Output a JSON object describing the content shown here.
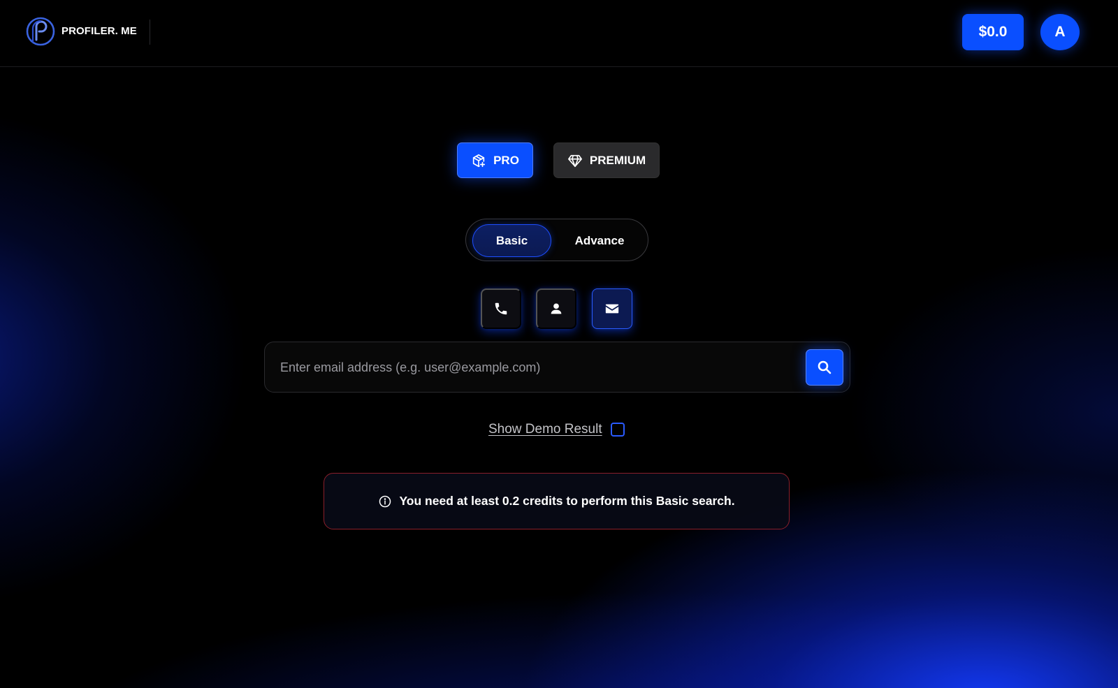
{
  "header": {
    "brand": "PROFILER. ME",
    "balance": "$0.0",
    "avatar_initial": "A"
  },
  "plans": [
    {
      "label": "PRO",
      "icon": "box-plus-icon",
      "selected": true
    },
    {
      "label": "PREMIUM",
      "icon": "diamond-icon",
      "selected": false
    }
  ],
  "mode": {
    "options": [
      "Basic",
      "Advance"
    ],
    "selected": "Basic"
  },
  "search_types": [
    {
      "icon": "phone-icon",
      "selected": false
    },
    {
      "icon": "person-icon",
      "selected": false
    },
    {
      "icon": "mail-icon",
      "selected": true
    }
  ],
  "search": {
    "placeholder": "Enter email address (e.g. user@example.com)",
    "value": ""
  },
  "demo": {
    "label": "Show Demo Result",
    "checked": false
  },
  "alert": {
    "message": "You need at least 0.2 credits to perform this Basic search."
  },
  "colors": {
    "accent": "#0a4fff",
    "background": "#000000",
    "alert_border": "#8a1f2b"
  }
}
